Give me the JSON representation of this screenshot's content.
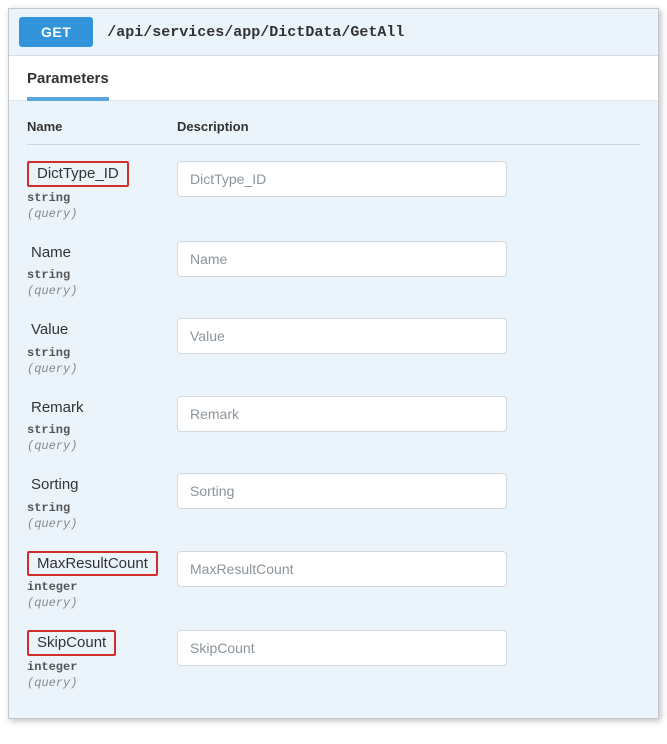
{
  "header": {
    "method": "GET",
    "path": "/api/services/app/DictData/GetAll"
  },
  "section": {
    "title": "Parameters"
  },
  "columns": {
    "name": "Name",
    "description": "Description"
  },
  "params": [
    {
      "name": "DictType_ID",
      "type": "string",
      "in": "(query)",
      "placeholder": "DictType_ID",
      "highlighted": true
    },
    {
      "name": "Name",
      "type": "string",
      "in": "(query)",
      "placeholder": "Name",
      "highlighted": false
    },
    {
      "name": "Value",
      "type": "string",
      "in": "(query)",
      "placeholder": "Value",
      "highlighted": false
    },
    {
      "name": "Remark",
      "type": "string",
      "in": "(query)",
      "placeholder": "Remark",
      "highlighted": false
    },
    {
      "name": "Sorting",
      "type": "string",
      "in": "(query)",
      "placeholder": "Sorting",
      "highlighted": false
    },
    {
      "name": "MaxResultCount",
      "type": "integer",
      "in": "(query)",
      "placeholder": "MaxResultCount",
      "highlighted": true
    },
    {
      "name": "SkipCount",
      "type": "integer",
      "in": "(query)",
      "placeholder": "SkipCount",
      "highlighted": true
    }
  ]
}
